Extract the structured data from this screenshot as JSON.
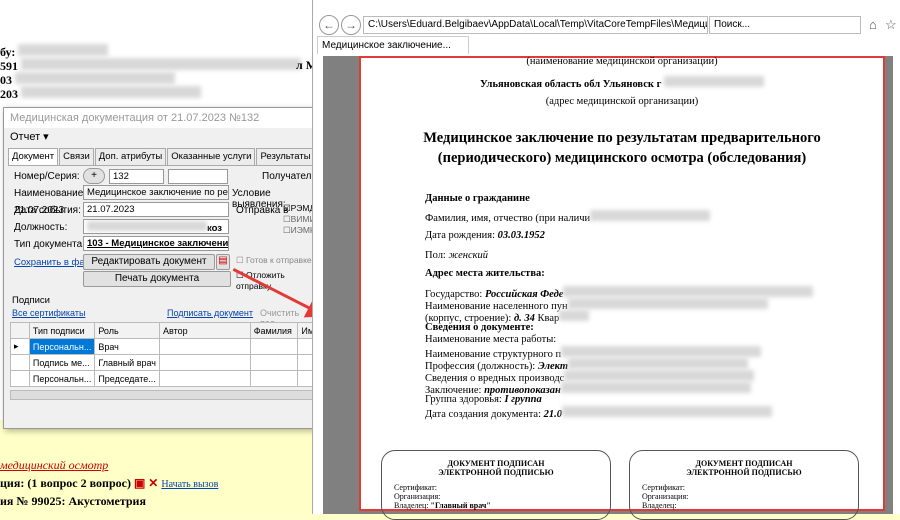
{
  "bg": {
    "line1": "бу:",
    "line2": "591",
    "line3": "03",
    "line4": "203",
    "right": "л М",
    "bottom1": "медицинский осмотр",
    "bottom2": "ция: (1 вопрос 2 вопрос)",
    "bottom2link": "Начать вызов",
    "bottom3": "ия № 99025: Акустометрия"
  },
  "dialog": {
    "title": "Медицинская документация от 21.07.2023 №132",
    "menu": "Отчет ▾",
    "tabs": [
      "Документ",
      "Связи",
      "Доп. атрибуты",
      "Оказанные услуги",
      "Результаты регистрации"
    ],
    "number_label": "Номер/Серия:",
    "plus": "+",
    "number": "132",
    "recipient_label": "Получатель:",
    "name_label": "Наименование:",
    "name_value": "Медицинское заключение по результатам",
    "cond_label": "Условие выявления:",
    "date_label": "Дата события:",
    "date_value": "21.07.2023",
    "send_label": "Отправка в",
    "remd": "РЭМД",
    "vimis": "ВИМИ",
    "iemk": "ИЭМК",
    "post_label": "Должность:",
    "post_tail": "коз",
    "doctype_label": "Тип документа:",
    "doctype_value": "103 - Медицинское заключение по",
    "save_link": "Сохранить в файл",
    "edit_btn": "Редактировать документ",
    "ready": "Готов к отправке",
    "postpone": "Отложить отправку",
    "print_btn": "Печать документа",
    "signs_label": "Подписи",
    "all_certs": "Все сертификаты",
    "sign_doc": "Подписать документ",
    "clear_sign": "Очистить под",
    "cols": [
      "",
      "Тип подписи",
      "Роль",
      "Автор",
      "Фамилия",
      "Им"
    ],
    "rows": [
      [
        "▸",
        "Персональн...",
        "Врач",
        "",
        "",
        ""
      ],
      [
        "",
        "Подпись ме...",
        "Главный врач",
        "",
        "",
        ""
      ],
      [
        "",
        "Персональн...",
        "Председате...",
        "",
        "",
        ""
      ]
    ]
  },
  "ie": {
    "address": "C:\\Users\\Eduard.Belgibaev\\AppData\\Local\\Temp\\VitaCoreTempFiles\\Медицинское з",
    "search": "Поиск...",
    "tab": "Медицинское заключение...",
    "back": "←",
    "fwd": "→"
  },
  "doc": {
    "org_name_note": "(наименование медицинской организации)",
    "region": "Ульяновская область обл Ульяновск г",
    "addr_note": "(адрес медицинской организации)",
    "title1": "Медицинское заключение по результатам предварительного",
    "title2": "(периодического) медицинского осмотра (обследования)",
    "citizen": "Данные о гражданине",
    "fio": "Фамилия, имя, отчество (при наличи",
    "birth_label": "Дата рождения:",
    "birth": "03.03.1952",
    "sex_label": "Пол:",
    "sex": "женский",
    "address_head": "Адрес места жительства:",
    "state_label": "Государство:",
    "state": "Российская Феде",
    "settlement": "Наименование населенного пун",
    "bld": "(корпус, строение):",
    "bld_val": "д. 34",
    "kv": "Квар",
    "docinfo": "Сведения о документе:",
    "work": "Наименование места работы:",
    "unit": "Наименование структурного п",
    "prof_label": "Профессия (должность):",
    "prof": "Элект",
    "harm": "Сведения о вредных производс",
    "concl_label": "Заключение:",
    "concl": "противопоказан",
    "group_label": "Группа здоровья:",
    "group": "I группа",
    "created_label": "Дата создания документа:",
    "created": "21.0",
    "sig1": "ДОКУМЕНТ ПОДПИСАН",
    "sig2": "ЭЛЕКТРОННОЙ ПОДПИСЬЮ",
    "cert": "Сертификат:",
    "org": "Организация:",
    "owner": "Владелец:",
    "owner_val": "\"Главный врач\""
  }
}
